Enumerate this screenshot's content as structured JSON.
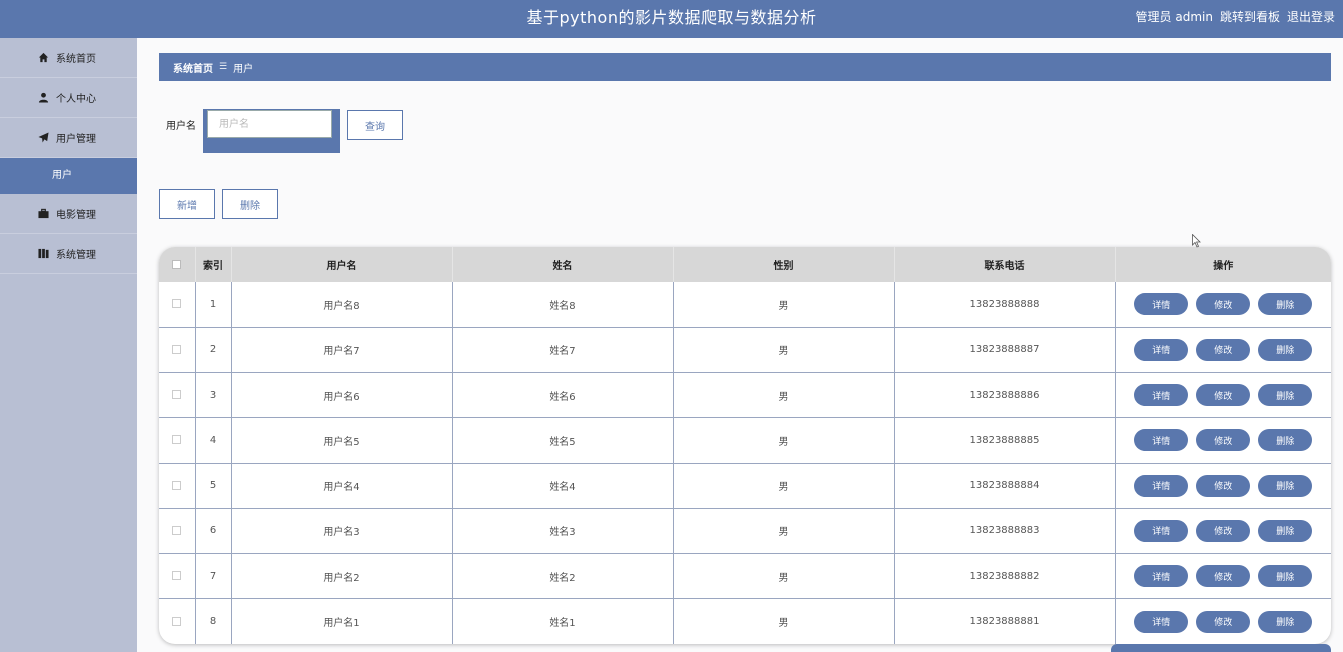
{
  "header": {
    "title": "基于python的影片数据爬取与数据分析",
    "admin": "管理员 admin",
    "dashboard_link": "跳转到看板",
    "logout": "退出登录"
  },
  "sidebar": {
    "items": [
      {
        "label": "系统首页",
        "icon": "home-icon"
      },
      {
        "label": "个人中心",
        "icon": "user-icon"
      },
      {
        "label": "用户管理",
        "icon": "send-icon"
      },
      {
        "label": "电影管理",
        "icon": "briefcase-icon"
      },
      {
        "label": "系统管理",
        "icon": "book-icon"
      }
    ],
    "active_sub": "用户"
  },
  "breadcrumb": {
    "home": "系统首页",
    "separator": "☰",
    "current": "用户"
  },
  "search": {
    "label": "用户名",
    "placeholder": "用户名",
    "value": "",
    "button": "查询"
  },
  "actions": {
    "add": "新增",
    "delete": "删除"
  },
  "table": {
    "headers": [
      "索引",
      "用户名",
      "姓名",
      "性别",
      "联系电话",
      "操作"
    ],
    "row_actions": [
      "详情",
      "修改",
      "删除"
    ],
    "rows": [
      {
        "index": "1",
        "username": "用户名8",
        "name": "姓名8",
        "gender": "男",
        "phone": "13823888888"
      },
      {
        "index": "2",
        "username": "用户名7",
        "name": "姓名7",
        "gender": "男",
        "phone": "13823888887"
      },
      {
        "index": "3",
        "username": "用户名6",
        "name": "姓名6",
        "gender": "男",
        "phone": "13823888886"
      },
      {
        "index": "4",
        "username": "用户名5",
        "name": "姓名5",
        "gender": "男",
        "phone": "13823888885"
      },
      {
        "index": "5",
        "username": "用户名4",
        "name": "姓名4",
        "gender": "男",
        "phone": "13823888884"
      },
      {
        "index": "6",
        "username": "用户名3",
        "name": "姓名3",
        "gender": "男",
        "phone": "13823888883"
      },
      {
        "index": "7",
        "username": "用户名2",
        "name": "姓名2",
        "gender": "男",
        "phone": "13823888882"
      },
      {
        "index": "8",
        "username": "用户名1",
        "name": "姓名1",
        "gender": "男",
        "phone": "13823888881"
      }
    ]
  },
  "colors": {
    "primary": "#5a77ad",
    "sidebar_bg": "#b8bfd3",
    "table_header_bg": "#d7d7d7"
  }
}
